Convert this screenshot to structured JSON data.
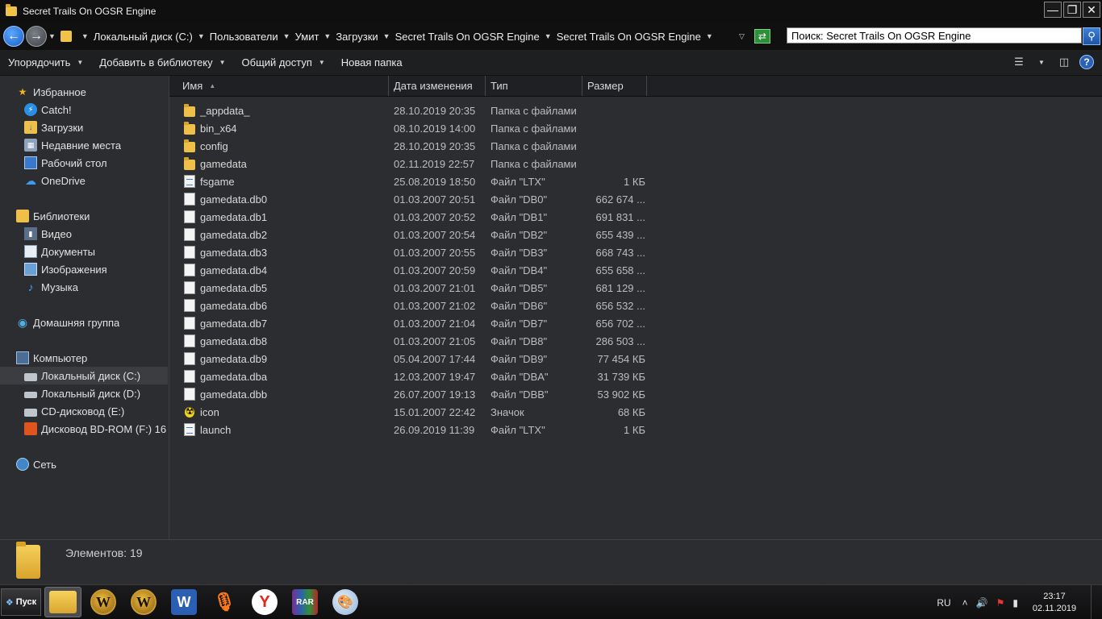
{
  "window": {
    "title": "Secret Trails On OGSR Engine",
    "minimize": "—",
    "maximize": "❐",
    "close": "✕"
  },
  "address": {
    "breadcrumbs": [
      "Локальный диск (C:)",
      "Пользователи",
      "Умит",
      "Загрузки",
      "Secret Trails On OGSR Engine",
      "Secret Trails On OGSR Engine"
    ],
    "search_value": "Поиск: Secret Trails On OGSR Engine"
  },
  "toolbar": {
    "organize": "Упорядочить",
    "add_to_library": "Добавить в библиотеку",
    "share": "Общий доступ",
    "new_folder": "Новая папка"
  },
  "sidebar": {
    "favorites": {
      "label": "Избранное",
      "items": [
        "Catch!",
        "Загрузки",
        "Недавние места",
        "Рабочий стол",
        "OneDrive"
      ]
    },
    "libraries": {
      "label": "Библиотеки",
      "items": [
        "Видео",
        "Документы",
        "Изображения",
        "Музыка"
      ]
    },
    "homegroup": {
      "label": "Домашняя группа"
    },
    "computer": {
      "label": "Компьютер",
      "items": [
        "Локальный диск (C:)",
        "Локальный диск (D:)",
        "CD-дисковод (E:)",
        "Дисковод BD-ROM (F:) 16"
      ]
    },
    "network": {
      "label": "Сеть"
    }
  },
  "columns": {
    "name": "Имя",
    "date": "Дата изменения",
    "type": "Тип",
    "size": "Размер"
  },
  "files": [
    {
      "name": "_appdata_",
      "date": "28.10.2019 20:35",
      "type": "Папка с файлами",
      "size": "",
      "icon": "folder-icon"
    },
    {
      "name": "bin_x64",
      "date": "08.10.2019 14:00",
      "type": "Папка с файлами",
      "size": "",
      "icon": "folder-icon"
    },
    {
      "name": "config",
      "date": "28.10.2019 20:35",
      "type": "Папка с файлами",
      "size": "",
      "icon": "folder-icon"
    },
    {
      "name": "gamedata",
      "date": "02.11.2019 22:57",
      "type": "Папка с файлами",
      "size": "",
      "icon": "folder-icon"
    },
    {
      "name": "fsgame",
      "date": "25.08.2019 18:50",
      "type": "Файл \"LTX\"",
      "size": "1 КБ",
      "icon": "ltx-file-icon"
    },
    {
      "name": "gamedata.db0",
      "date": "01.03.2007 20:51",
      "type": "Файл \"DB0\"",
      "size": "662 674 ...",
      "icon": "file-icon"
    },
    {
      "name": "gamedata.db1",
      "date": "01.03.2007 20:52",
      "type": "Файл \"DB1\"",
      "size": "691 831 ...",
      "icon": "file-icon"
    },
    {
      "name": "gamedata.db2",
      "date": "01.03.2007 20:54",
      "type": "Файл \"DB2\"",
      "size": "655 439 ...",
      "icon": "file-icon"
    },
    {
      "name": "gamedata.db3",
      "date": "01.03.2007 20:55",
      "type": "Файл \"DB3\"",
      "size": "668 743 ...",
      "icon": "file-icon"
    },
    {
      "name": "gamedata.db4",
      "date": "01.03.2007 20:59",
      "type": "Файл \"DB4\"",
      "size": "655 658 ...",
      "icon": "file-icon"
    },
    {
      "name": "gamedata.db5",
      "date": "01.03.2007 21:01",
      "type": "Файл \"DB5\"",
      "size": "681 129 ...",
      "icon": "file-icon"
    },
    {
      "name": "gamedata.db6",
      "date": "01.03.2007 21:02",
      "type": "Файл \"DB6\"",
      "size": "656 532 ...",
      "icon": "file-icon"
    },
    {
      "name": "gamedata.db7",
      "date": "01.03.2007 21:04",
      "type": "Файл \"DB7\"",
      "size": "656 702 ...",
      "icon": "file-icon"
    },
    {
      "name": "gamedata.db8",
      "date": "01.03.2007 21:05",
      "type": "Файл \"DB8\"",
      "size": "286 503 ...",
      "icon": "file-icon"
    },
    {
      "name": "gamedata.db9",
      "date": "05.04.2007 17:44",
      "type": "Файл \"DB9\"",
      "size": "77 454 КБ",
      "icon": "file-icon"
    },
    {
      "name": "gamedata.dba",
      "date": "12.03.2007 19:47",
      "type": "Файл \"DBA\"",
      "size": "31 739 КБ",
      "icon": "file-icon"
    },
    {
      "name": "gamedata.dbb",
      "date": "26.07.2007 19:13",
      "type": "Файл \"DBB\"",
      "size": "53 902 КБ",
      "icon": "file-icon"
    },
    {
      "name": "icon",
      "date": "15.01.2007 22:42",
      "type": "Значок",
      "size": "68 КБ",
      "icon": "radiation-icon"
    },
    {
      "name": "launch",
      "date": "26.09.2019 11:39",
      "type": "Файл \"LTX\"",
      "size": "1 КБ",
      "icon": "ltx-file-icon"
    }
  ],
  "details": {
    "count": "Элементов: 19"
  },
  "taskbar": {
    "start": "Пуск",
    "lang": "RU",
    "time": "23:17",
    "date": "02.11.2019",
    "apps": [
      {
        "name": "explorer",
        "glyph": ""
      },
      {
        "name": "wow-1",
        "glyph": "W"
      },
      {
        "name": "wow-2",
        "glyph": "W"
      },
      {
        "name": "word",
        "glyph": "W"
      },
      {
        "name": "microphone",
        "glyph": "🎙"
      },
      {
        "name": "yandex",
        "glyph": "Y"
      },
      {
        "name": "winrar",
        "glyph": "RAR"
      },
      {
        "name": "paint",
        "glyph": "🎨"
      }
    ]
  }
}
